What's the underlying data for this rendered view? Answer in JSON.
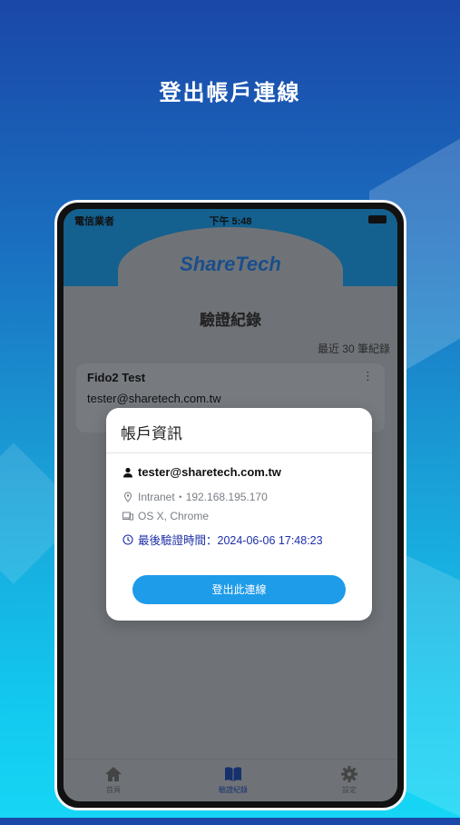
{
  "headline": "登出帳戶連線",
  "statusbar": {
    "carrier": "電信業者",
    "time": "下午 5:48"
  },
  "logo_text": "ShareTech",
  "page_title": "驗證紀錄",
  "recent_label": "最近 30 筆紀錄",
  "card": {
    "title": "Fido2 Test",
    "email": "tester@sharetech.com.tw"
  },
  "modal": {
    "title": "帳戶資訊",
    "user": "tester@sharetech.com.tw",
    "network": "Intranet・192.168.195.170",
    "os": "OS X, Chrome",
    "last_verified": "最後驗證時間：2024-06-06 17:48:23",
    "logout_button": "登出此連線"
  },
  "tabs": [
    {
      "label": "首頁",
      "icon": "home-icon"
    },
    {
      "label": "驗證紀錄",
      "icon": "book-icon"
    },
    {
      "label": "設定",
      "icon": "gear-icon"
    }
  ],
  "colors": {
    "accent": "#1e9be9",
    "time_text": "#1d2fa7"
  }
}
